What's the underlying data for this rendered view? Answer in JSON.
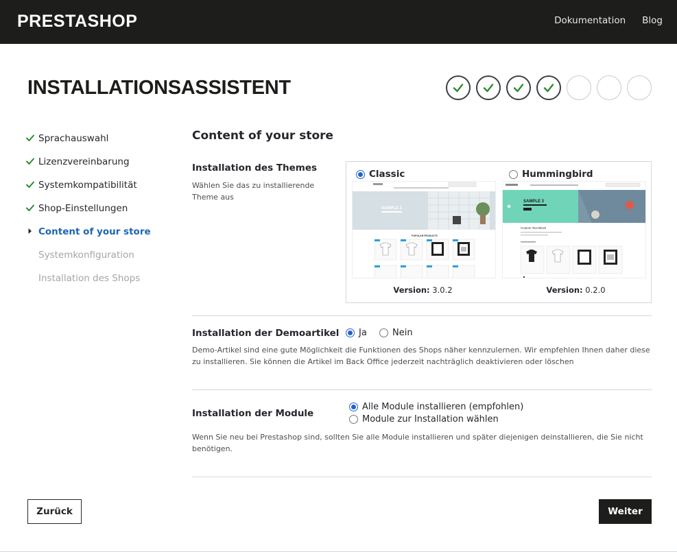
{
  "header": {
    "logo": "PRESTASHOP",
    "nav": [
      "Dokumentation",
      "Blog"
    ]
  },
  "page": {
    "title": "INSTALLATIONSASSISTENT"
  },
  "progress": {
    "total_steps": 7,
    "completed_steps": 4
  },
  "sidebar": {
    "items": [
      {
        "label": "Sprachauswahl",
        "state": "done"
      },
      {
        "label": "Lizenzvereinbarung",
        "state": "done"
      },
      {
        "label": "Systemkompatibilität",
        "state": "done"
      },
      {
        "label": "Shop-Einstellungen",
        "state": "done"
      },
      {
        "label": "Content of your store",
        "state": "current"
      },
      {
        "label": "Systemkonfiguration",
        "state": "pending"
      },
      {
        "label": "Installation des Shops",
        "state": "pending"
      }
    ]
  },
  "content": {
    "title": "Content of your store",
    "theme": {
      "label": "Installation des Themes",
      "help": "Wählen Sie das zu installierende Theme aus",
      "version_label": "Version:",
      "options": [
        {
          "name": "Classic",
          "version": "3.0.2",
          "selected": true,
          "preview_banner": "SAMPLE 1",
          "preview_section": "POPULAR PRODUCTS"
        },
        {
          "name": "Hummingbird",
          "version": "0.2.0",
          "selected": false,
          "preview_banner": "SAMPLE 3",
          "preview_section": "Custom Text Block"
        }
      ]
    },
    "demo": {
      "label": "Installation der Demoartikel",
      "yes": "Ja",
      "no": "Nein",
      "selected": "yes",
      "help": "Demo-Artikel sind eine gute Möglichkeit die Funktionen des Shops näher kennzulernen. Wir empfehlen Ihnen daher diese zu installieren. Sie können die Artikel im Back Office jederzeit nachträglich deaktivieren oder löschen"
    },
    "modules": {
      "label": "Installation der Module",
      "options": [
        "Alle Module installieren (empfohlen)",
        "Module zur Installation wählen"
      ],
      "selected_index": 0,
      "help": "Wenn Sie neu bei Prestashop sind, sollten Sie alle Module installieren und später diejenigen deinstallieren, die Sie nicht benötigen."
    }
  },
  "buttons": {
    "back": "Zurück",
    "next": "Weiter"
  },
  "colors": {
    "topbar": "#1d1d1b",
    "accent": "#1f66b1",
    "check": "#2f8a2f",
    "radio": "#2563c8",
    "hummingbird_teal": "#6fd4b8"
  }
}
